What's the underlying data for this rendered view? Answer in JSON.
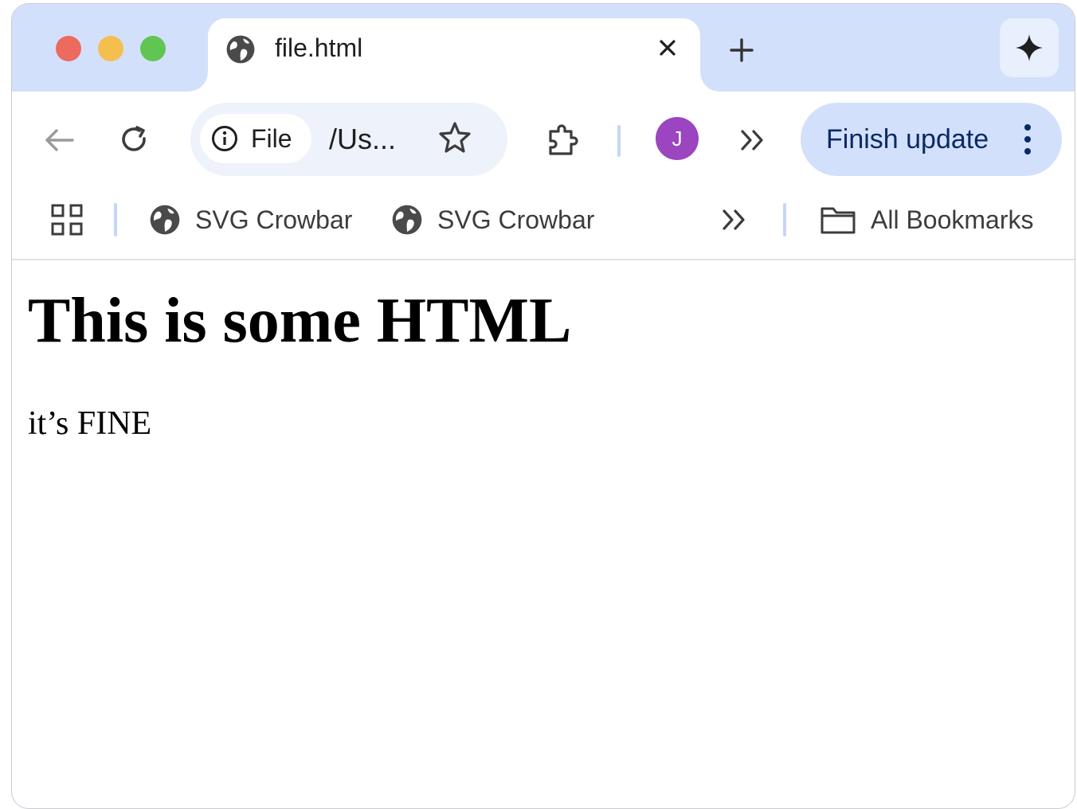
{
  "tab": {
    "title": "file.html"
  },
  "omnibox": {
    "chip_label": "File",
    "url": "/Us..."
  },
  "profile": {
    "initial": "J"
  },
  "update": {
    "label": "Finish update"
  },
  "bookmarks": {
    "items": [
      {
        "label": "SVG Crowbar"
      },
      {
        "label": "SVG Crowbar"
      }
    ],
    "all_label": "All Bookmarks"
  },
  "page": {
    "heading": "This is some HTML",
    "paragraph": "it’s FINE"
  },
  "colors": {
    "tabstrip": "#d3e0fb",
    "avatar": "#9b45c0",
    "update_button": "#d3e0fb"
  },
  "icons": [
    "globe-icon",
    "close-icon",
    "plus-icon",
    "sparkle-icon",
    "back-arrow-icon",
    "reload-icon",
    "info-icon",
    "star-icon",
    "extensions-icon",
    "chevron-double-right-icon",
    "kebab-menu-icon",
    "apps-grid-icon",
    "folder-icon"
  ]
}
